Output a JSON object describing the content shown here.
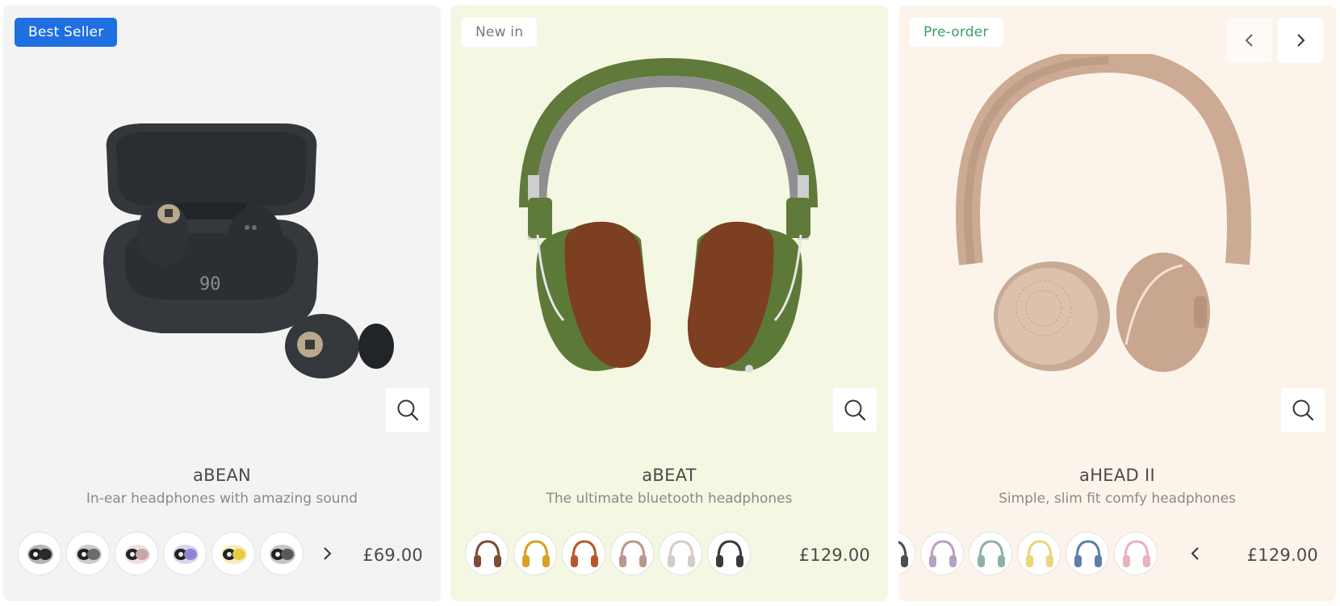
{
  "colors": {
    "blue_badge": "#1f6fe0",
    "preorder_text": "#3f9a6a",
    "card_bg_1": "#f3f3f3",
    "card_bg_2": "#f4f7e2",
    "card_bg_3": "#fcf4ea"
  },
  "products": [
    {
      "badge": "Best Seller",
      "name": "aBEAN",
      "description": "In-ear headphones with amazing sound",
      "price": "£69.00",
      "image": "earbuds-charging-case",
      "swatch_colors": [
        "#2a2a2a",
        "#6b6b6b",
        "#c9a7a6",
        "#8e86d0",
        "#e7cc3e",
        "#5a5a5a"
      ]
    },
    {
      "badge": "New in",
      "name": "aBEAT",
      "description": "The ultimate bluetooth headphones",
      "price": "£129.00",
      "image": "over-ear-headphones-green",
      "swatch_colors": [
        "#7a4d36",
        "#d9a020",
        "#b8582a",
        "#b9988a",
        "#d6cbc6",
        "#3a3a3a"
      ]
    },
    {
      "badge": "Pre-order",
      "name": "aHEAD II",
      "description": "Simple, slim fit comfy headphones",
      "price": "£129.00",
      "image": "on-ear-headphones-beige",
      "swatch_colors": [
        "#4d4d4d",
        "#b7a0c2",
        "#8fb1a4",
        "#e7d77a",
        "#5d7fa6",
        "#e6b3be"
      ]
    }
  ]
}
